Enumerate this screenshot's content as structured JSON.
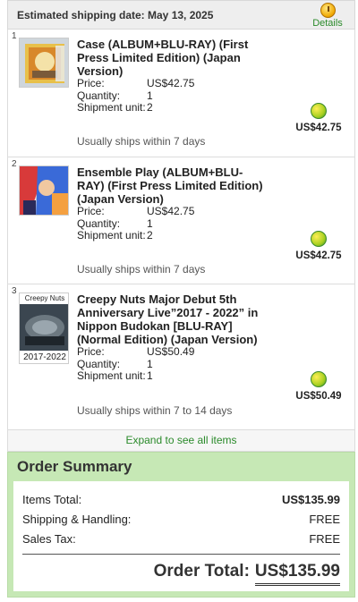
{
  "header": {
    "shipping_label": "Estimated shipping date: May 13, 2025",
    "details_label": "Details"
  },
  "items": [
    {
      "index": "1",
      "name": "Case (ALBUM+BLU-RAY) (First Press Limited Edition) (Japan Version)",
      "price_label": "Price:",
      "price": "US$42.75",
      "quantity_label": "Quantity:",
      "quantity": "1",
      "shipment_label": "Shipment unit:",
      "shipment": "2",
      "ships_text": "Usually ships within 7 days",
      "line_total": "US$42.75"
    },
    {
      "index": "2",
      "name": "Ensemble Play (ALBUM+BLU-RAY) (First Press Limited Edition) (Japan Version)",
      "price_label": "Price:",
      "price": "US$42.75",
      "quantity_label": "Quantity:",
      "quantity": "1",
      "shipment_label": "Shipment unit:",
      "shipment": "2",
      "ships_text": "Usually ships within 7 days",
      "line_total": "US$42.75"
    },
    {
      "index": "3",
      "name": "Creepy Nuts Major Debut 5th Anniversary Live”2017 - 2022” in Nippon Budokan [BLU-RAY] (Normal Edition) (Japan Version)",
      "price_label": "Price:",
      "price": "US$50.49",
      "quantity_label": "Quantity:",
      "quantity": "1",
      "shipment_label": "Shipment unit:",
      "shipment": "1",
      "ships_text": "Usually ships within 7 to 14 days",
      "line_total": "US$50.49",
      "cover_text_top": "Creepy Nuts",
      "cover_text_bottom": "2017-2022"
    }
  ],
  "expand_label": "Expand to see all items",
  "summary": {
    "title": "Order Summary",
    "items_total_label": "Items Total:",
    "items_total": "US$135.99",
    "shipping_label": "Shipping & Handling:",
    "shipping": "FREE",
    "tax_label": "Sales Tax:",
    "tax": "FREE",
    "order_total_label": "Order Total:",
    "order_total": "US$135.99"
  },
  "colors": {
    "accent_green": "#2a8a2a",
    "summary_bg": "#c6e8b5"
  },
  "icons": {
    "details": "clock-icon",
    "item_badge": "earth-points-icon"
  }
}
